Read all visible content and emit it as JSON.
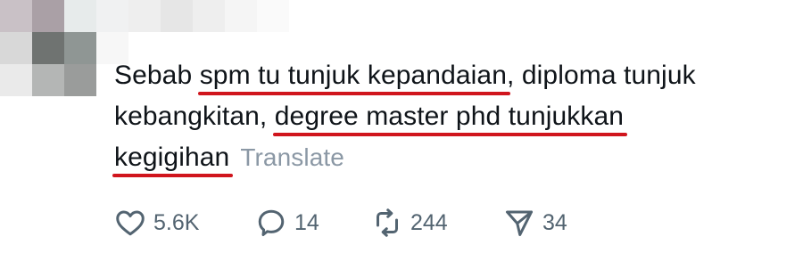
{
  "tweet": {
    "segments": [
      [
        "Sebab ",
        "spm tu tunjuk kepandaian",
        ", diploma tunjuk"
      ],
      [
        "kebangkitan, ",
        "degree master phd tunjukkan"
      ],
      [
        "",
        "kegigihan"
      ]
    ],
    "translate_label": "Translate"
  },
  "actions": {
    "likes": "5.6K",
    "replies": "14",
    "retweets": "244",
    "shares": "34"
  },
  "colors": {
    "highlight_underline": "#d0151d",
    "muted": "#536471",
    "translate": "#8b98a5"
  },
  "icons": [
    "heart-icon",
    "reply-bubble-icon",
    "retweet-icon",
    "share-icon"
  ]
}
